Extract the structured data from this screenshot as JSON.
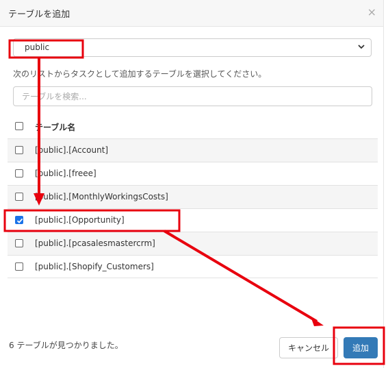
{
  "dialog": {
    "title": "テーブルを追加",
    "close_icon": "close-icon",
    "close_glyph": "×"
  },
  "schema_select": {
    "value": "public",
    "options": [
      "public"
    ]
  },
  "instruction": "次のリストからタスクとして追加するテーブルを選択してください。",
  "search": {
    "placeholder": "テーブルを検索...",
    "value": ""
  },
  "table": {
    "column_header": "テーブル名",
    "rows": [
      {
        "name": "[public].[Account]",
        "checked": false
      },
      {
        "name": "[public].[freee]",
        "checked": false
      },
      {
        "name": "[public].[MonthlyWorkingsCosts]",
        "checked": false
      },
      {
        "name": "[public].[Opportunity]",
        "checked": true
      },
      {
        "name": "[public].[pcasalesmastercrm]",
        "checked": false
      },
      {
        "name": "[public].[Shopify_Customers]",
        "checked": false
      }
    ]
  },
  "footer": {
    "status": "6 テーブルが見つかりました。",
    "cancel_label": "キャンセル",
    "add_label": "追加"
  },
  "colors": {
    "annotation": "#e8000e",
    "primary_button": "#337ab7",
    "checkbox_checked": "#1a73e8"
  }
}
